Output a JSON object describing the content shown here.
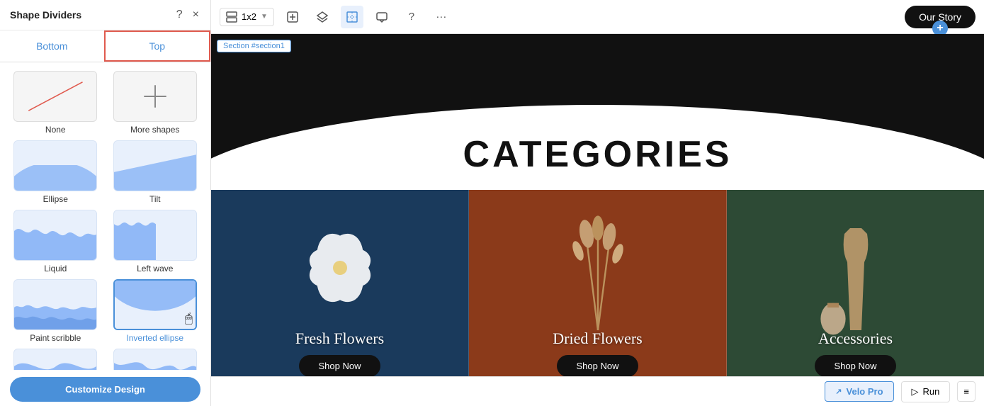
{
  "panel": {
    "title": "Shape Dividers",
    "help_label": "?",
    "close_label": "×",
    "tabs": [
      {
        "id": "bottom",
        "label": "Bottom",
        "active": false
      },
      {
        "id": "top",
        "label": "Top",
        "active": true
      }
    ],
    "shapes": [
      {
        "id": "none",
        "label": "None",
        "type": "none"
      },
      {
        "id": "more-shapes",
        "label": "More shapes",
        "type": "more"
      },
      {
        "id": "ellipse",
        "label": "Ellipse",
        "type": "ellipse"
      },
      {
        "id": "tilt",
        "label": "Tilt",
        "type": "tilt"
      },
      {
        "id": "liquid",
        "label": "Liquid",
        "type": "liquid"
      },
      {
        "id": "left-wave",
        "label": "Left wave",
        "type": "leftwave"
      },
      {
        "id": "paint-scribble",
        "label": "Paint scribble",
        "type": "paintscribble"
      },
      {
        "id": "inverted-ellipse",
        "label": "Inverted ellipse",
        "type": "invertedellipse",
        "selected": true
      }
    ],
    "partial_shapes": [
      {
        "id": "partial1",
        "label": "",
        "type": "bottom1"
      },
      {
        "id": "partial2",
        "label": "",
        "type": "bottom2"
      }
    ],
    "customize_btn": "Customize Design"
  },
  "toolbar": {
    "layout": "1x2",
    "nav_pill_label": "Our Story",
    "plus_label": "+"
  },
  "section_label": "Section #section1",
  "canvas": {
    "title": "CATEGORIES",
    "products": [
      {
        "name": "Fresh Flowers",
        "btn": "Shop Now",
        "bg": "1"
      },
      {
        "name": "Dried Flowers",
        "btn": "Shop Now",
        "bg": "2"
      },
      {
        "name": "Accessories",
        "btn": "Shop Now",
        "bg": "3"
      }
    ]
  },
  "bottom_bar": {
    "velo_pro_label": "Velo Pro",
    "run_label": "▷ Run",
    "settings_label": "≡"
  }
}
